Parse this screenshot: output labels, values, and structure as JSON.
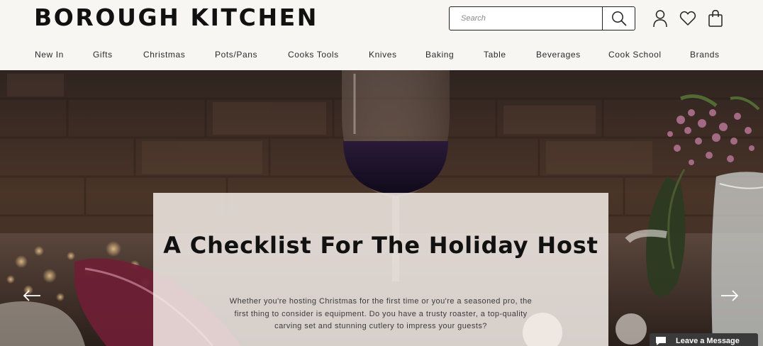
{
  "header": {
    "logo_text": "BOROUGH KITCHEN",
    "search": {
      "placeholder": "Search",
      "value": ""
    },
    "icons": [
      "search-icon",
      "account-icon",
      "wishlist-heart-icon",
      "shopping-bag-icon"
    ]
  },
  "nav": {
    "items": [
      {
        "label": "New In"
      },
      {
        "label": "Gifts"
      },
      {
        "label": "Christmas"
      },
      {
        "label": "Pots/Pans"
      },
      {
        "label": "Cooks Tools"
      },
      {
        "label": "Knives"
      },
      {
        "label": "Baking"
      },
      {
        "label": "Table"
      },
      {
        "label": "Beverages"
      },
      {
        "label": "Cook School"
      },
      {
        "label": "Brands"
      }
    ]
  },
  "hero": {
    "title": "A Checklist For The Holiday Host",
    "body": "Whether you're hosting Christmas for the first time or you're a seasoned pro, the first thing to consider is equipment. Do you have a trusty roaster, a top-quality carving set and stunning cutlery to impress your guests?",
    "prev_icon": "arrow-left-icon",
    "next_icon": "arrow-right-icon"
  },
  "chat": {
    "label": "Leave a Message",
    "icon": "chat-bubble-icon"
  },
  "colors": {
    "header_bg": "#f7f6f3",
    "text_dark": "#111111",
    "card_bg": "#f3ece8",
    "chat_bg": "#3a3a3a"
  }
}
